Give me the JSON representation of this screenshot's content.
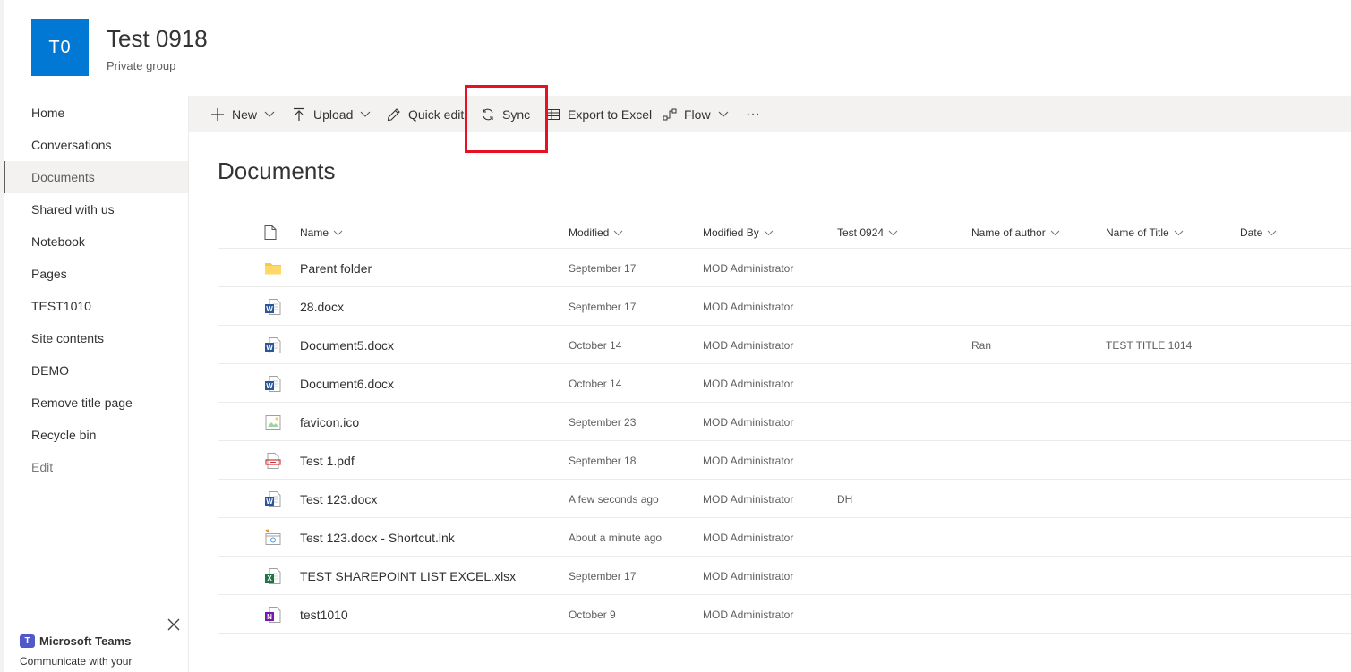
{
  "site": {
    "logo_text": "T0",
    "title": "Test 0918",
    "subtitle": "Private group",
    "logo_color": "#0078d4"
  },
  "nav": {
    "items": [
      {
        "label": "Home",
        "state": "normal"
      },
      {
        "label": "Conversations",
        "state": "normal"
      },
      {
        "label": "Documents",
        "state": "active"
      },
      {
        "label": "Shared with us",
        "state": "normal"
      },
      {
        "label": "Notebook",
        "state": "normal"
      },
      {
        "label": "Pages",
        "state": "normal"
      },
      {
        "label": "TEST1010",
        "state": "normal"
      },
      {
        "label": "Site contents",
        "state": "normal"
      },
      {
        "label": "DEMO",
        "state": "normal"
      },
      {
        "label": "Remove title page",
        "state": "normal"
      },
      {
        "label": "Recycle bin",
        "state": "normal"
      },
      {
        "label": "Edit",
        "state": "muted"
      }
    ]
  },
  "teams": {
    "title": "Microsoft Teams",
    "description": "Communicate with your"
  },
  "commands": {
    "new_label": "New",
    "upload_label": "Upload",
    "quick_edit_label": "Quick edit",
    "sync_label": "Sync",
    "export_label": "Export to Excel",
    "flow_label": "Flow",
    "more_label": "···"
  },
  "highlight_color": "#e81123",
  "main": {
    "heading": "Documents"
  },
  "columns": {
    "name": "Name",
    "modified": "Modified",
    "modified_by": "Modified By",
    "test0924": "Test 0924",
    "name_of_author": "Name of author",
    "name_of_title": "Name of Title",
    "date": "Date"
  },
  "rows": [
    {
      "icon": "folder-icon",
      "name": "Parent folder",
      "modified": "September 17",
      "modified_by": "MOD Administrator",
      "test0924": "",
      "author": "",
      "title": "",
      "date": ""
    },
    {
      "icon": "word-icon",
      "name": "28.docx",
      "modified": "September 17",
      "modified_by": "MOD Administrator",
      "test0924": "",
      "author": "",
      "title": "",
      "date": ""
    },
    {
      "icon": "word-icon",
      "name": "Document5.docx",
      "modified": "October 14",
      "modified_by": "MOD Administrator",
      "test0924": "",
      "author": "Ran",
      "title": "TEST TITLE 1014",
      "date": ""
    },
    {
      "icon": "word-icon",
      "name": "Document6.docx",
      "modified": "October 14",
      "modified_by": "MOD Administrator",
      "test0924": "",
      "author": "",
      "title": "",
      "date": ""
    },
    {
      "icon": "image-icon",
      "name": "favicon.ico",
      "modified": "September 23",
      "modified_by": "MOD Administrator",
      "test0924": "",
      "author": "",
      "title": "",
      "date": ""
    },
    {
      "icon": "pdf-icon",
      "name": "Test 1.pdf",
      "modified": "September 18",
      "modified_by": "MOD Administrator",
      "test0924": "",
      "author": "",
      "title": "",
      "date": ""
    },
    {
      "icon": "word-icon",
      "name": "Test 123.docx",
      "modified": "A few seconds ago",
      "modified_by": "MOD Administrator",
      "test0924": "DH",
      "author": "",
      "title": "",
      "date": ""
    },
    {
      "icon": "link-icon",
      "name": "Test 123.docx - Shortcut.lnk",
      "modified": "About a minute ago",
      "modified_by": "MOD Administrator",
      "test0924": "",
      "author": "",
      "title": "",
      "date": ""
    },
    {
      "icon": "excel-icon",
      "name": "TEST SHAREPOINT LIST EXCEL.xlsx",
      "modified": "September 17",
      "modified_by": "MOD Administrator",
      "test0924": "",
      "author": "",
      "title": "",
      "date": ""
    },
    {
      "icon": "onenote-icon",
      "name": "test1010",
      "modified": "October 9",
      "modified_by": "MOD Administrator",
      "test0924": "",
      "author": "",
      "title": "",
      "date": ""
    }
  ]
}
